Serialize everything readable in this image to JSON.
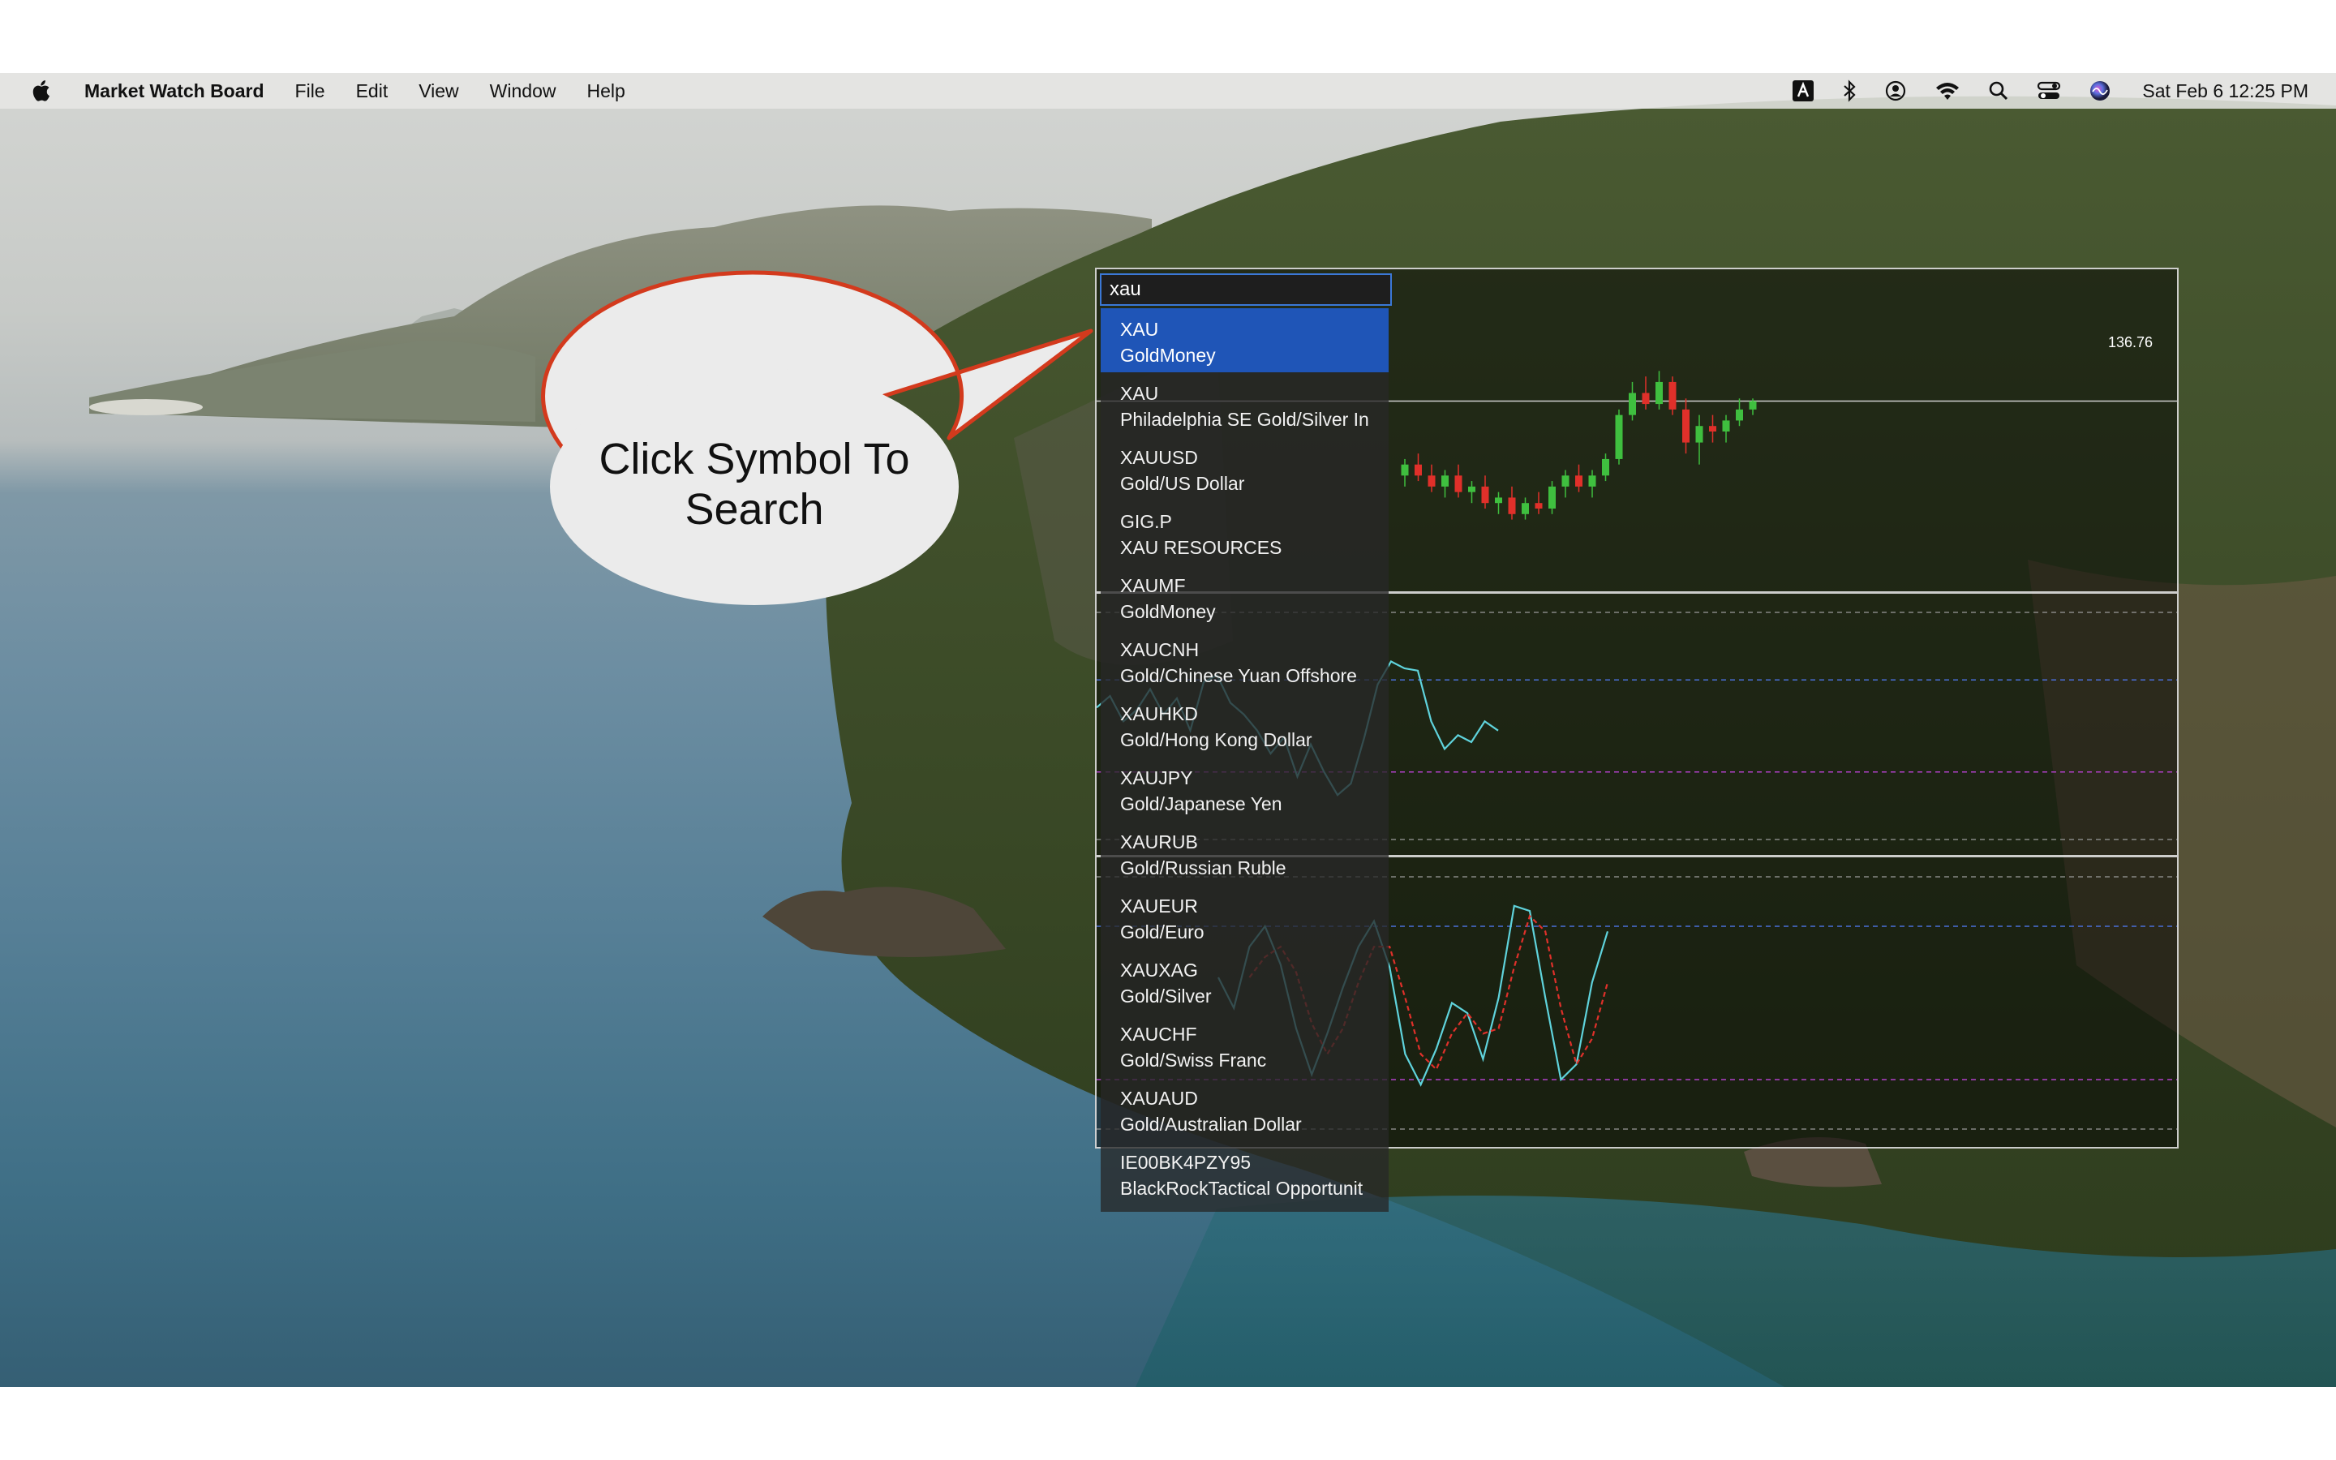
{
  "menubar": {
    "app_name": "Market Watch Board",
    "menus": [
      "File",
      "Edit",
      "View",
      "Window",
      "Help"
    ],
    "status_icons": [
      "keyboard-input-icon",
      "bluetooth-icon",
      "user-account-icon",
      "wifi-icon",
      "spotlight-search-icon",
      "control-center-icon",
      "siri-icon"
    ],
    "clock": "Sat Feb 6  12:25 PM"
  },
  "search": {
    "query": "xau",
    "results": [
      {
        "symbol": "XAU",
        "name": "GoldMoney",
        "selected": true
      },
      {
        "symbol": "XAU",
        "name": "Philadelphia SE Gold/Silver In"
      },
      {
        "symbol": "XAUUSD",
        "name": "Gold/US Dollar"
      },
      {
        "symbol": "GIG.P",
        "name": "XAU RESOURCES"
      },
      {
        "symbol": "XAUMF",
        "name": "GoldMoney"
      },
      {
        "symbol": "XAUCNH",
        "name": "Gold/Chinese Yuan Offshore"
      },
      {
        "symbol": "XAUHKD",
        "name": "Gold/Hong Kong Dollar"
      },
      {
        "symbol": "XAUJPY",
        "name": "Gold/Japanese Yen"
      },
      {
        "symbol": "XAURUB",
        "name": "Gold/Russian Ruble"
      },
      {
        "symbol": "XAUEUR",
        "name": "Gold/Euro"
      },
      {
        "symbol": "XAUXAG",
        "name": "Gold/Silver"
      },
      {
        "symbol": "XAUCHF",
        "name": "Gold/Swiss Franc"
      },
      {
        "symbol": "XAUAUD",
        "name": "Gold/Australian Dollar"
      },
      {
        "symbol": "IE00BK4PZY95",
        "name": "BlackRockTactical Opportunit"
      }
    ]
  },
  "callout": {
    "line1": "Click Symbol To",
    "line2": "Search"
  },
  "chart": {
    "last_price_label": "136.76",
    "colors": {
      "up": "#3fbf3f",
      "down": "#e0302a",
      "rsi": "#5fd3dc",
      "signal": "#e0302a",
      "overbought": "#4a6fd9",
      "oversold": "#b040c8"
    }
  },
  "chart_data": [
    {
      "type": "candlestick",
      "title": "",
      "last_price": 136.76,
      "ylim": [
        120,
        148
      ],
      "candles": [
        {
          "o": 130.0,
          "h": 131.5,
          "l": 129.0,
          "c": 131.0
        },
        {
          "o": 131.0,
          "h": 132.0,
          "l": 129.5,
          "c": 130.0
        },
        {
          "o": 130.0,
          "h": 131.0,
          "l": 128.5,
          "c": 129.0
        },
        {
          "o": 129.0,
          "h": 130.5,
          "l": 128.0,
          "c": 130.0
        },
        {
          "o": 130.0,
          "h": 131.0,
          "l": 128.0,
          "c": 128.5
        },
        {
          "o": 128.5,
          "h": 129.5,
          "l": 127.5,
          "c": 129.0
        },
        {
          "o": 129.0,
          "h": 130.0,
          "l": 127.0,
          "c": 127.5
        },
        {
          "o": 127.5,
          "h": 128.5,
          "l": 126.5,
          "c": 128.0
        },
        {
          "o": 128.0,
          "h": 129.0,
          "l": 126.0,
          "c": 126.5
        },
        {
          "o": 126.5,
          "h": 128.0,
          "l": 126.0,
          "c": 127.5
        },
        {
          "o": 127.5,
          "h": 128.5,
          "l": 126.5,
          "c": 127.0
        },
        {
          "o": 127.0,
          "h": 129.5,
          "l": 126.5,
          "c": 129.0
        },
        {
          "o": 129.0,
          "h": 130.5,
          "l": 128.0,
          "c": 130.0
        },
        {
          "o": 130.0,
          "h": 131.0,
          "l": 128.5,
          "c": 129.0
        },
        {
          "o": 129.0,
          "h": 130.5,
          "l": 128.0,
          "c": 130.0
        },
        {
          "o": 130.0,
          "h": 132.0,
          "l": 129.5,
          "c": 131.5
        },
        {
          "o": 131.5,
          "h": 136.0,
          "l": 131.0,
          "c": 135.5
        },
        {
          "o": 135.5,
          "h": 138.5,
          "l": 135.0,
          "c": 137.5
        },
        {
          "o": 137.5,
          "h": 139.0,
          "l": 136.0,
          "c": 136.5
        },
        {
          "o": 136.5,
          "h": 139.5,
          "l": 136.0,
          "c": 138.5
        },
        {
          "o": 138.5,
          "h": 139.0,
          "l": 135.5,
          "c": 136.0
        },
        {
          "o": 136.0,
          "h": 137.0,
          "l": 132.0,
          "c": 133.0
        },
        {
          "o": 133.0,
          "h": 135.5,
          "l": 131.0,
          "c": 134.5
        },
        {
          "o": 134.5,
          "h": 135.5,
          "l": 133.0,
          "c": 134.0
        },
        {
          "o": 134.0,
          "h": 135.5,
          "l": 133.0,
          "c": 135.0
        },
        {
          "o": 135.0,
          "h": 137.0,
          "l": 134.5,
          "c": 136.0
        },
        {
          "o": 136.0,
          "h": 137.0,
          "l": 135.5,
          "c": 136.76
        }
      ]
    },
    {
      "type": "line",
      "title": "",
      "ylim": [
        0,
        100
      ],
      "levels": [
        70,
        30
      ],
      "series": [
        {
          "values": [
            58,
            63,
            52,
            57,
            66,
            55,
            62,
            48,
            69,
            72,
            60,
            55,
            48,
            38,
            45,
            28,
            42,
            30,
            20,
            25,
            45,
            68,
            78,
            75,
            74,
            52,
            40,
            46,
            43,
            52,
            48
          ]
        }
      ]
    },
    {
      "type": "line",
      "title": "",
      "ylim": [
        0,
        100
      ],
      "levels": [
        80,
        20
      ],
      "series": [
        {
          "values": [
            60,
            48,
            72,
            80,
            65,
            40,
            22,
            38,
            56,
            72,
            82,
            64,
            30,
            18,
            32,
            50,
            46,
            28,
            52,
            88,
            86,
            52,
            20,
            26,
            58,
            78
          ]
        },
        {
          "values": [
            null,
            null,
            60,
            68,
            72,
            62,
            42,
            30,
            40,
            58,
            72,
            72,
            52,
            30,
            24,
            38,
            46,
            38,
            40,
            64,
            84,
            78,
            48,
            26,
            36,
            58
          ]
        }
      ]
    }
  ]
}
